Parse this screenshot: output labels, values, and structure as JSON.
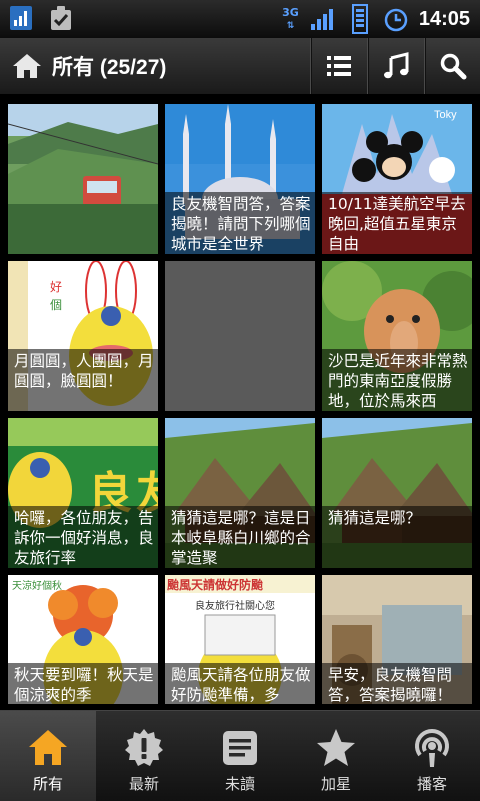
{
  "status_bar": {
    "network": "3G",
    "time": "14:05"
  },
  "app_bar": {
    "title": "所有 (25/27)"
  },
  "tiles": [
    {
      "caption": ""
    },
    {
      "caption": "良友機智問答，答案揭曉！請問下列哪個城市是全世界"
    },
    {
      "caption": "10/11達美航空早去晚回,超值五星東京自由"
    },
    {
      "caption": "月圓圓，人團圓，月圓圓，臉圓圓！"
    },
    {
      "caption": ""
    },
    {
      "caption": "沙巴是近年來非常熱門的東南亞度假勝地，位於馬來西"
    },
    {
      "caption": "哈囉，各位朋友，告訴你一個好消息，良友旅行率"
    },
    {
      "caption": "猜猜這是哪？這是日本岐阜縣白川鄉的合掌造聚"
    },
    {
      "caption": "猜猜這是哪？"
    },
    {
      "caption": "秋天要到囉！秋天是個涼爽的季"
    },
    {
      "caption": "颱風天請各位朋友做好防颱準備，多"
    },
    {
      "caption": "早安，良友機智問答，答案揭曉囉！"
    }
  ],
  "bottom_nav": {
    "items": [
      {
        "label": "所有",
        "icon": "home-icon"
      },
      {
        "label": "最新",
        "icon": "badge-alert-icon"
      },
      {
        "label": "未讀",
        "icon": "document-icon"
      },
      {
        "label": "加星",
        "icon": "star-icon"
      },
      {
        "label": "播客",
        "icon": "podcast-icon"
      }
    ]
  },
  "colors": {
    "active_nav": "#f5a623",
    "inactive_icon": "#c8c8c8"
  }
}
